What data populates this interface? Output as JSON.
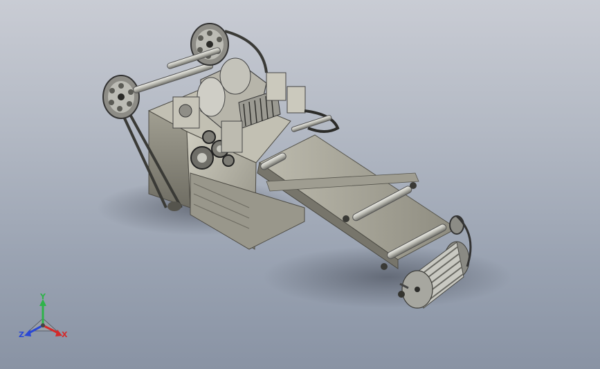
{
  "axis_triad": {
    "x_label": "X",
    "y_label": "Y",
    "z_label": "Z",
    "x_color": "#d42a2a",
    "y_color": "#2fb34a",
    "z_color": "#2a48d4"
  },
  "colors": {
    "machine_body": "#b9b6a8",
    "machine_shadow": "#6f6d63",
    "conveyor": "#a9a79a",
    "metal": "#d8d8d2"
  }
}
